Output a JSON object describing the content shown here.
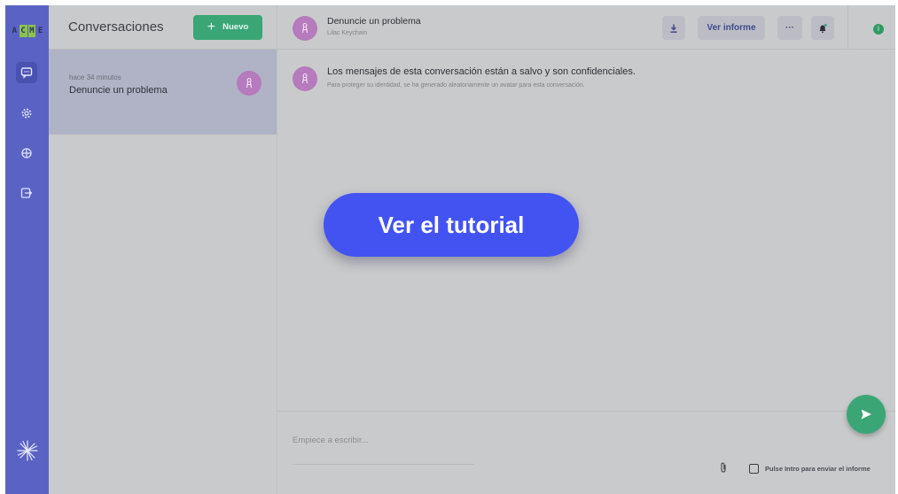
{
  "rail": {
    "logo_letters": [
      "A",
      "C",
      "M",
      "E"
    ]
  },
  "list": {
    "title": "Conversaciones",
    "new_label": "Nuevo",
    "items": [
      {
        "time": "hace 34 minutos",
        "name": "Denuncie un problema"
      }
    ]
  },
  "chat": {
    "title": "Denuncie un problema",
    "subtitle": "Lilac Keychain",
    "report_label": "Ver informe",
    "more_label": "···",
    "info_label": "i",
    "message_title": "Los mensajes de esta conversación están a salvo y son confidenciales.",
    "message_body": "Para proteger su identidad, se ha generado aleatoriamente un avatar para esta conversación.",
    "compose_placeholder": "Empiece a escribir...",
    "enter_to_send_label": "Pulse Intro para enviar el informe"
  },
  "tutorial_label": "Ver el tutorial",
  "colors": {
    "rail": "#5a63c3",
    "accent_green": "#3aa676",
    "avatar": "#b57bbd",
    "tutorial": "#4353f2"
  },
  "icons": [
    "chat-icon",
    "settings-icon",
    "globe-icon",
    "logout-icon",
    "spark-logo-icon",
    "download-icon",
    "bell-icon",
    "send-icon",
    "paperclip-icon",
    "keychain-avatar-icon"
  ]
}
